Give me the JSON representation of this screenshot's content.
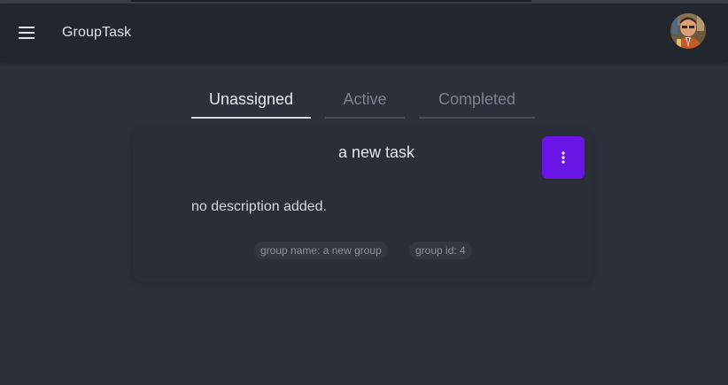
{
  "appbar": {
    "title": "GroupTask",
    "menu_icon": "hamburger-menu-icon",
    "avatar": "user-avatar"
  },
  "tabs": [
    {
      "label": "Unassigned",
      "active": true
    },
    {
      "label": "Active",
      "active": false
    },
    {
      "label": "Completed",
      "active": false
    }
  ],
  "task": {
    "title": "a new task",
    "description": "no description added.",
    "group_name_chip": "group name: a new group",
    "group_id_chip": "group id: 4",
    "menu_icon": "more-vertical-icon"
  },
  "colors": {
    "background": "#2b303b",
    "appbar": "#22262e",
    "accent": "#6a14e6"
  }
}
